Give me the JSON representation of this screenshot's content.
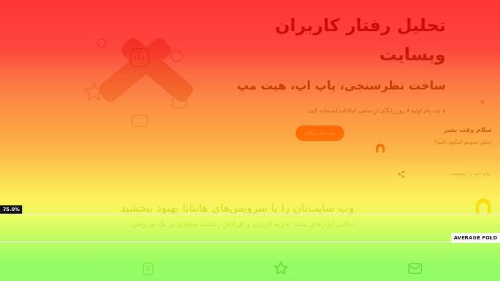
{
  "hero": {
    "title_line1": "تحلیل رفتار کاربران",
    "title_line2": "وبسایت",
    "subtitle": "ساخت نظرسنجی، پاپ اپ، هیت مپ",
    "description": "با ثبت نام اولیه ۷ روز رایگان از تمامی امکانات استفاده کنید.",
    "cta_label": "ثبت نام رایگان"
  },
  "chat": {
    "close": "×",
    "greeting": "سلام وقت بخیر",
    "greeting_sub": "چطور میتونیم کمکتون کنیم؟",
    "input_placeholder": "پیام خود را بنویسید..."
  },
  "features": {
    "title": "وب سایت‌تان را با سرویس‌های هانتانا بهبود ببخشید",
    "description": "تمامی ابزارهای تست تجربه کاربری و افزایش رضایت مشتری در یک سرویس"
  },
  "heatmap": {
    "scroll_marker_label": "75.0%",
    "fold_label": "AVERAGE FOLD",
    "scroll_marker_percent": 75.0
  },
  "colors": {
    "cta": "#ff2a10",
    "hot": "#ff0000",
    "cold": "#6eff37"
  }
}
